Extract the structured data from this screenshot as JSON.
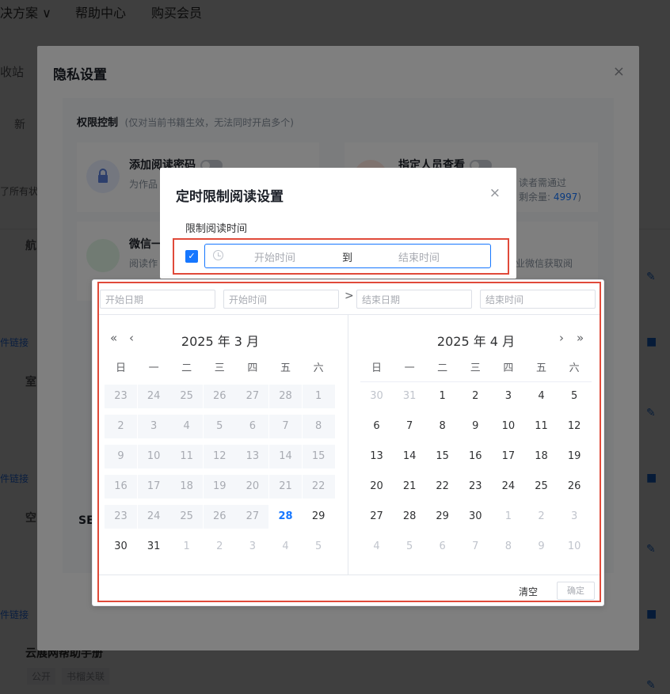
{
  "background": {
    "nav": [
      "决方案 ∨",
      "帮助中心",
      "购买会员"
    ],
    "left_labels": [
      "收站",
      "新",
      "了所有状",
      "航",
      "室",
      "空",
      "SE"
    ],
    "links": [
      "件链接",
      "件链接",
      "件链接"
    ],
    "tags": [
      "公开",
      "书榴关联"
    ],
    "bottom_title": "云展网帮助手册"
  },
  "privacy": {
    "title": "隐私设置",
    "close": "×",
    "perm_label": "权限控制",
    "perm_sub": "(仅对当前书籍生效，无法同时开启多个)",
    "cards": [
      {
        "title": "添加阅读密码",
        "desc": "为作品"
      },
      {
        "title": "指定人员查看",
        "desc": "读者需通过",
        "desc2": "剩余量:",
        "count": "4997",
        "desc3": ")"
      },
      {
        "title": "微信一",
        "desc": "阅读作",
        "desc2": "业微信获取阅"
      }
    ],
    "se_label": "SE"
  },
  "timed": {
    "title": "定时限制阅读设置",
    "close": "×",
    "label": "限制阅读时间",
    "checkbox_checked": true,
    "range": {
      "start_placeholder": "开始时间",
      "separator": "到",
      "end_placeholder": "结束时间"
    }
  },
  "picker": {
    "inputs": {
      "start_date": "开始日期",
      "start_time": "开始时间",
      "end_date": "结束日期",
      "end_time": "结束时间"
    },
    "arrow": ">",
    "nav": {
      "prev_year": "«",
      "prev_month": "‹",
      "next_month": "›",
      "next_year": "»"
    },
    "left_title": "2025 年 3 月",
    "right_title": "2025 年 4 月",
    "weekdays": [
      "日",
      "一",
      "二",
      "三",
      "四",
      "五",
      "六"
    ],
    "left_days": [
      [
        "23",
        "24",
        "25",
        "26",
        "27",
        "28",
        "1"
      ],
      [
        "2",
        "3",
        "4",
        "5",
        "6",
        "7",
        "8"
      ],
      [
        "9",
        "10",
        "11",
        "12",
        "13",
        "14",
        "15"
      ],
      [
        "16",
        "17",
        "18",
        "19",
        "20",
        "21",
        "22"
      ],
      [
        "23",
        "24",
        "25",
        "26",
        "27",
        "28",
        "29"
      ],
      [
        "30",
        "31",
        "1",
        "2",
        "3",
        "4",
        "5"
      ]
    ],
    "right_days": [
      [
        "30",
        "31",
        "1",
        "2",
        "3",
        "4",
        "5"
      ],
      [
        "6",
        "7",
        "8",
        "9",
        "10",
        "11",
        "12"
      ],
      [
        "13",
        "14",
        "15",
        "16",
        "17",
        "18",
        "19"
      ],
      [
        "20",
        "21",
        "22",
        "23",
        "24",
        "25",
        "26"
      ],
      [
        "27",
        "28",
        "29",
        "30",
        "1",
        "2",
        "3"
      ],
      [
        "4",
        "5",
        "6",
        "7",
        "8",
        "9",
        "10"
      ]
    ],
    "today": "28",
    "clear_label": "清空",
    "ok_label": "确定"
  }
}
